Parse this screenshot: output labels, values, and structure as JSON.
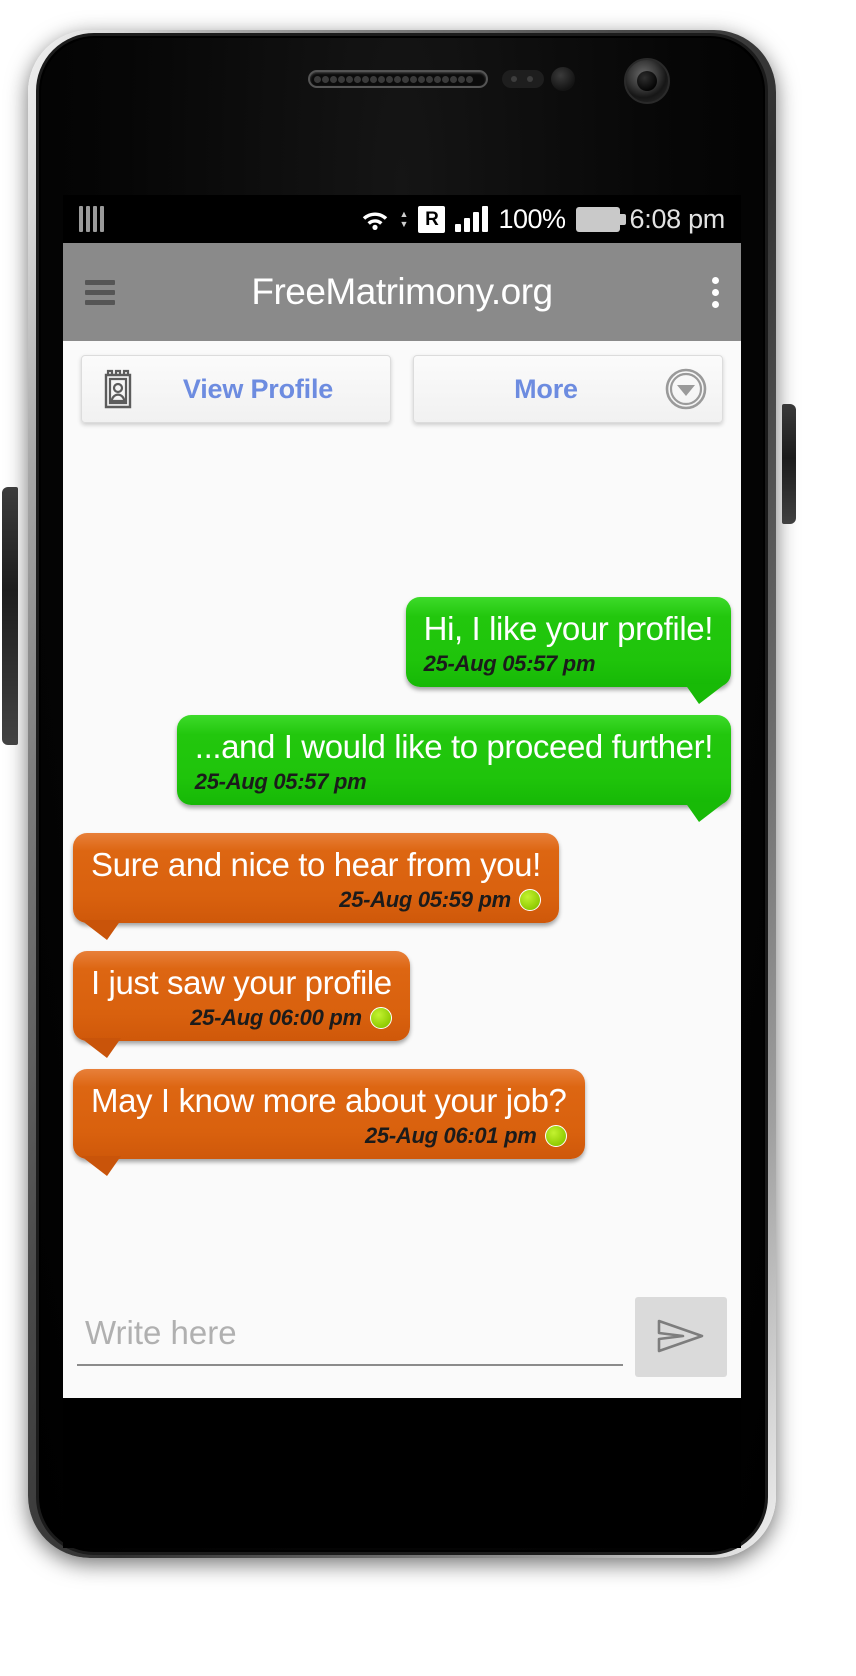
{
  "status_bar": {
    "sim_icon": "sim-bars-icon",
    "wifi_icon": "wifi-icon",
    "data_arrows_icon": "data-transfer-arrows-icon",
    "roaming_label": "R",
    "signal_icon": "signal-bars-icon",
    "battery_percent": "100%",
    "battery_icon": "battery-full-icon",
    "time": "6:08 pm"
  },
  "action_bar": {
    "menu_icon": "hamburger-menu-icon",
    "title": "FreeMatrimony.org",
    "overflow_icon": "overflow-menu-icon"
  },
  "tabs": [
    {
      "label": "View Profile",
      "icon": "contact-card-icon",
      "icon_side": "left"
    },
    {
      "label": "More",
      "icon": "chevron-down-circle-icon",
      "icon_side": "right"
    }
  ],
  "messages": [
    {
      "side": "out",
      "color": "green",
      "text": "Hi, I like your profile!",
      "timestamp": "25-Aug 05:57 pm",
      "has_status_dot": false
    },
    {
      "side": "out",
      "color": "green",
      "text": "...and I would like to proceed further!",
      "timestamp": "25-Aug 05:57 pm",
      "has_status_dot": false
    },
    {
      "side": "in",
      "color": "orange",
      "text": "Sure and nice to hear from you!",
      "timestamp": "25-Aug 05:59 pm",
      "has_status_dot": true
    },
    {
      "side": "in",
      "color": "orange",
      "text": "I just saw your profile",
      "timestamp": "25-Aug 06:00 pm",
      "has_status_dot": true
    },
    {
      "side": "in",
      "color": "orange",
      "text": "May I know more about your job?",
      "timestamp": "25-Aug 06:01 pm",
      "has_status_dot": true
    }
  ],
  "composer": {
    "placeholder": "Write here",
    "value": "",
    "send_icon": "send-paper-plane-icon"
  },
  "colors": {
    "outgoing_bubble": "#22c70d",
    "incoming_bubble": "#dd6612",
    "action_bar": "#8a8a8a",
    "tab_label": "#6d8ce0",
    "status_dot": "#9ccf00",
    "screen_bg": "#fafafa"
  }
}
